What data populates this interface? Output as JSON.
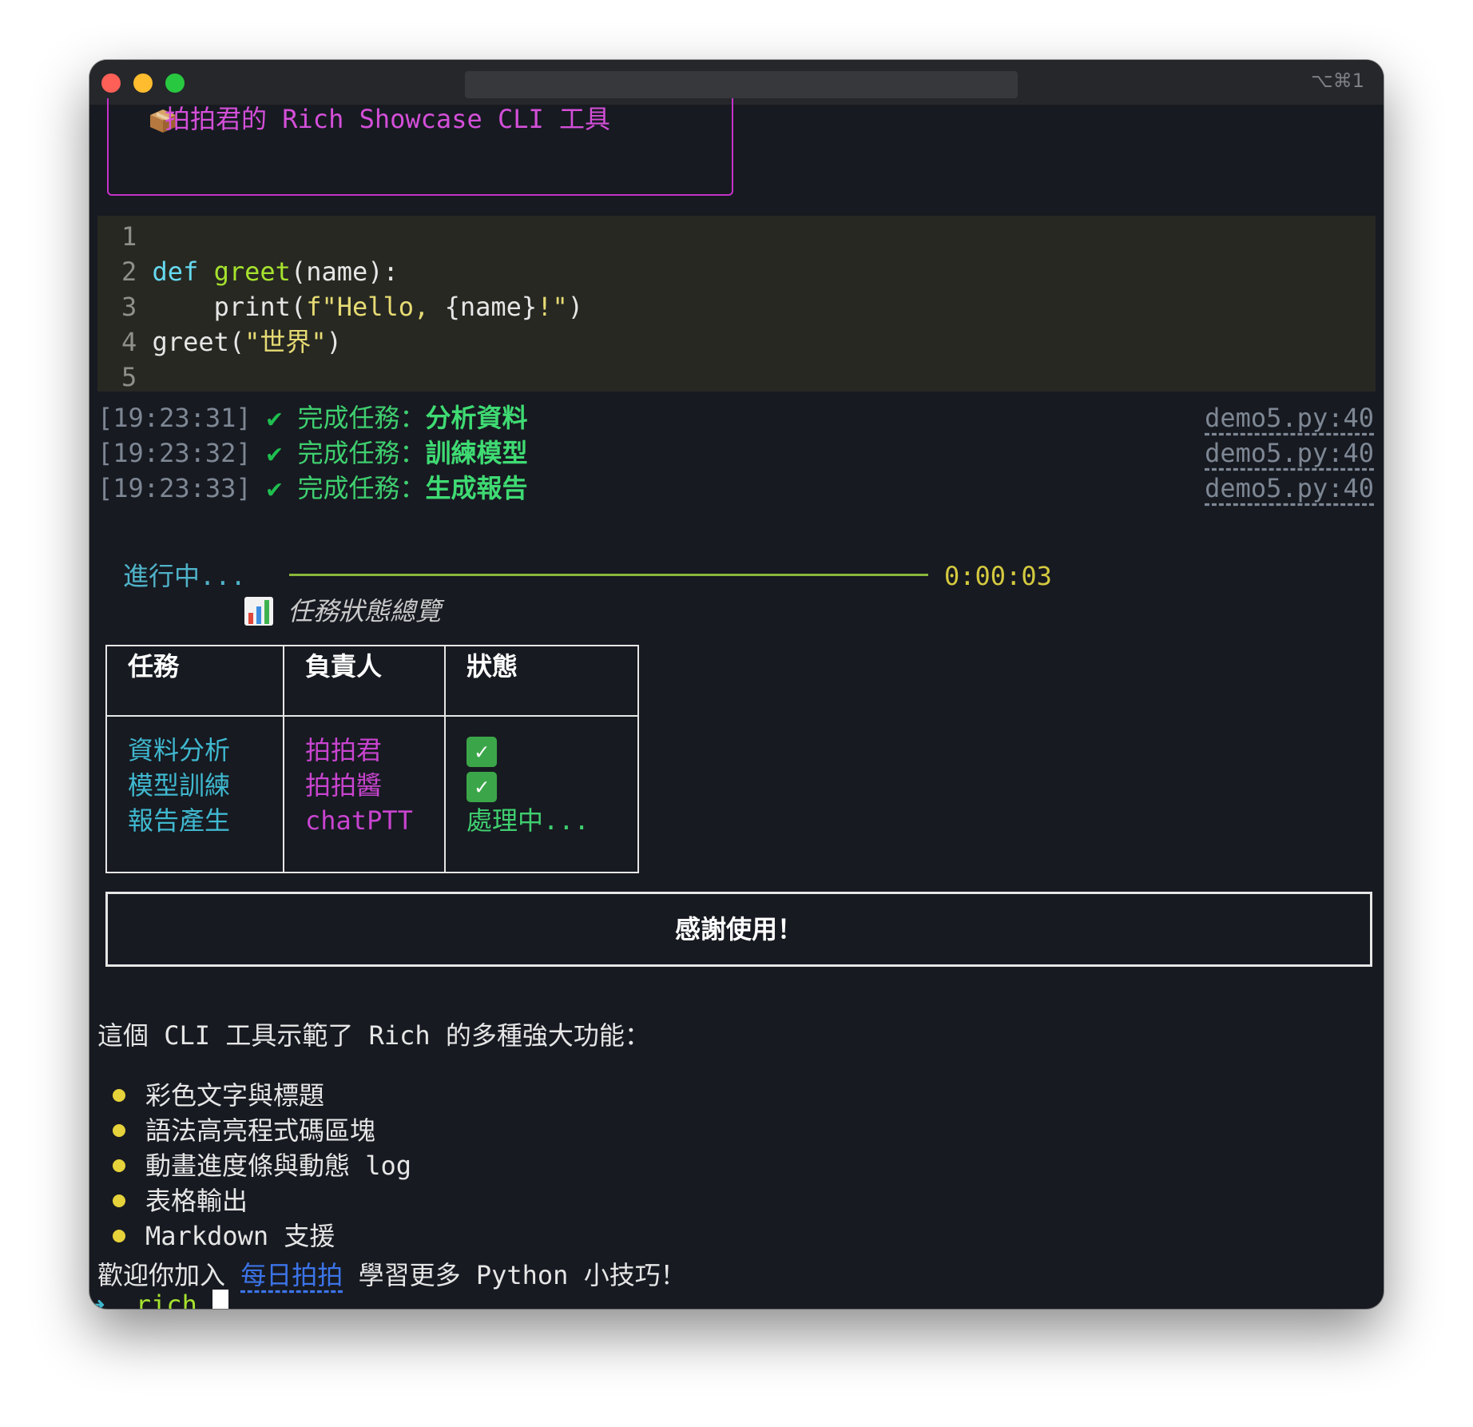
{
  "window": {
    "shortcut": "⌥⌘1"
  },
  "title_panel": {
    "icon": "package-icon",
    "text": "拍拍君的 Rich Showcase CLI 工具",
    "border_color": "#c532c9"
  },
  "code": {
    "lines": [
      {
        "num": "1",
        "tokens": []
      },
      {
        "num": "2",
        "tokens": [
          {
            "t": "def",
            "c": "kw"
          },
          {
            "t": " ",
            "c": ""
          },
          {
            "t": "greet",
            "c": "fn"
          },
          {
            "t": "(name):",
            "c": ""
          }
        ]
      },
      {
        "num": "3",
        "tokens": [
          {
            "t": "    print(",
            "c": ""
          },
          {
            "t": "f\"Hello, ",
            "c": "str"
          },
          {
            "t": "{name}",
            "c": ""
          },
          {
            "t": "!\"",
            "c": "str"
          },
          {
            "t": ")",
            "c": ""
          }
        ]
      },
      {
        "num": "4",
        "tokens": [
          {
            "t": "greet(",
            "c": ""
          },
          {
            "t": "\"世界\"",
            "c": "str"
          },
          {
            "t": ")",
            "c": ""
          }
        ]
      },
      {
        "num": "5",
        "tokens": []
      }
    ]
  },
  "logs": [
    {
      "time": "[19:23:31]",
      "check": "✔",
      "prefix": "完成任務：",
      "name": "分析資料",
      "source": "demo5.py:40"
    },
    {
      "time": "[19:23:32]",
      "check": "✔",
      "prefix": "完成任務：",
      "name": "訓練模型",
      "source": "demo5.py:40"
    },
    {
      "time": "[19:23:33]",
      "check": "✔",
      "prefix": "完成任務：",
      "name": "生成報告",
      "source": "demo5.py:40"
    }
  ],
  "progress": {
    "label": "進行中...",
    "elapsed": "0:00:03",
    "fraction": 1.0
  },
  "table": {
    "title": "任務狀態總覽",
    "title_icon": "bar-chart-icon",
    "headers": [
      "任務",
      "負責人",
      "狀態"
    ],
    "tasks": [
      "資料分析",
      "模型訓練",
      "報告產生"
    ],
    "owners": [
      "拍拍君",
      "拍拍醬",
      "chatPTT"
    ],
    "statuses": [
      "✅",
      "✅",
      "處理中..."
    ]
  },
  "thanks": "感謝使用！",
  "markdown": {
    "intro": "這個 CLI 工具示範了 Rich 的多種強大功能：",
    "bullets": [
      "彩色文字與標題",
      "語法高亮程式碼區塊",
      "動畫進度條與動態 log",
      "表格輸出",
      "Markdown 支援"
    ],
    "outro_before": "歡迎你加入 ",
    "outro_link": "每日拍拍",
    "outro_after": " 學習更多 Python 小技巧！"
  },
  "prompt": {
    "arrow": "➜",
    "command": "rich"
  }
}
